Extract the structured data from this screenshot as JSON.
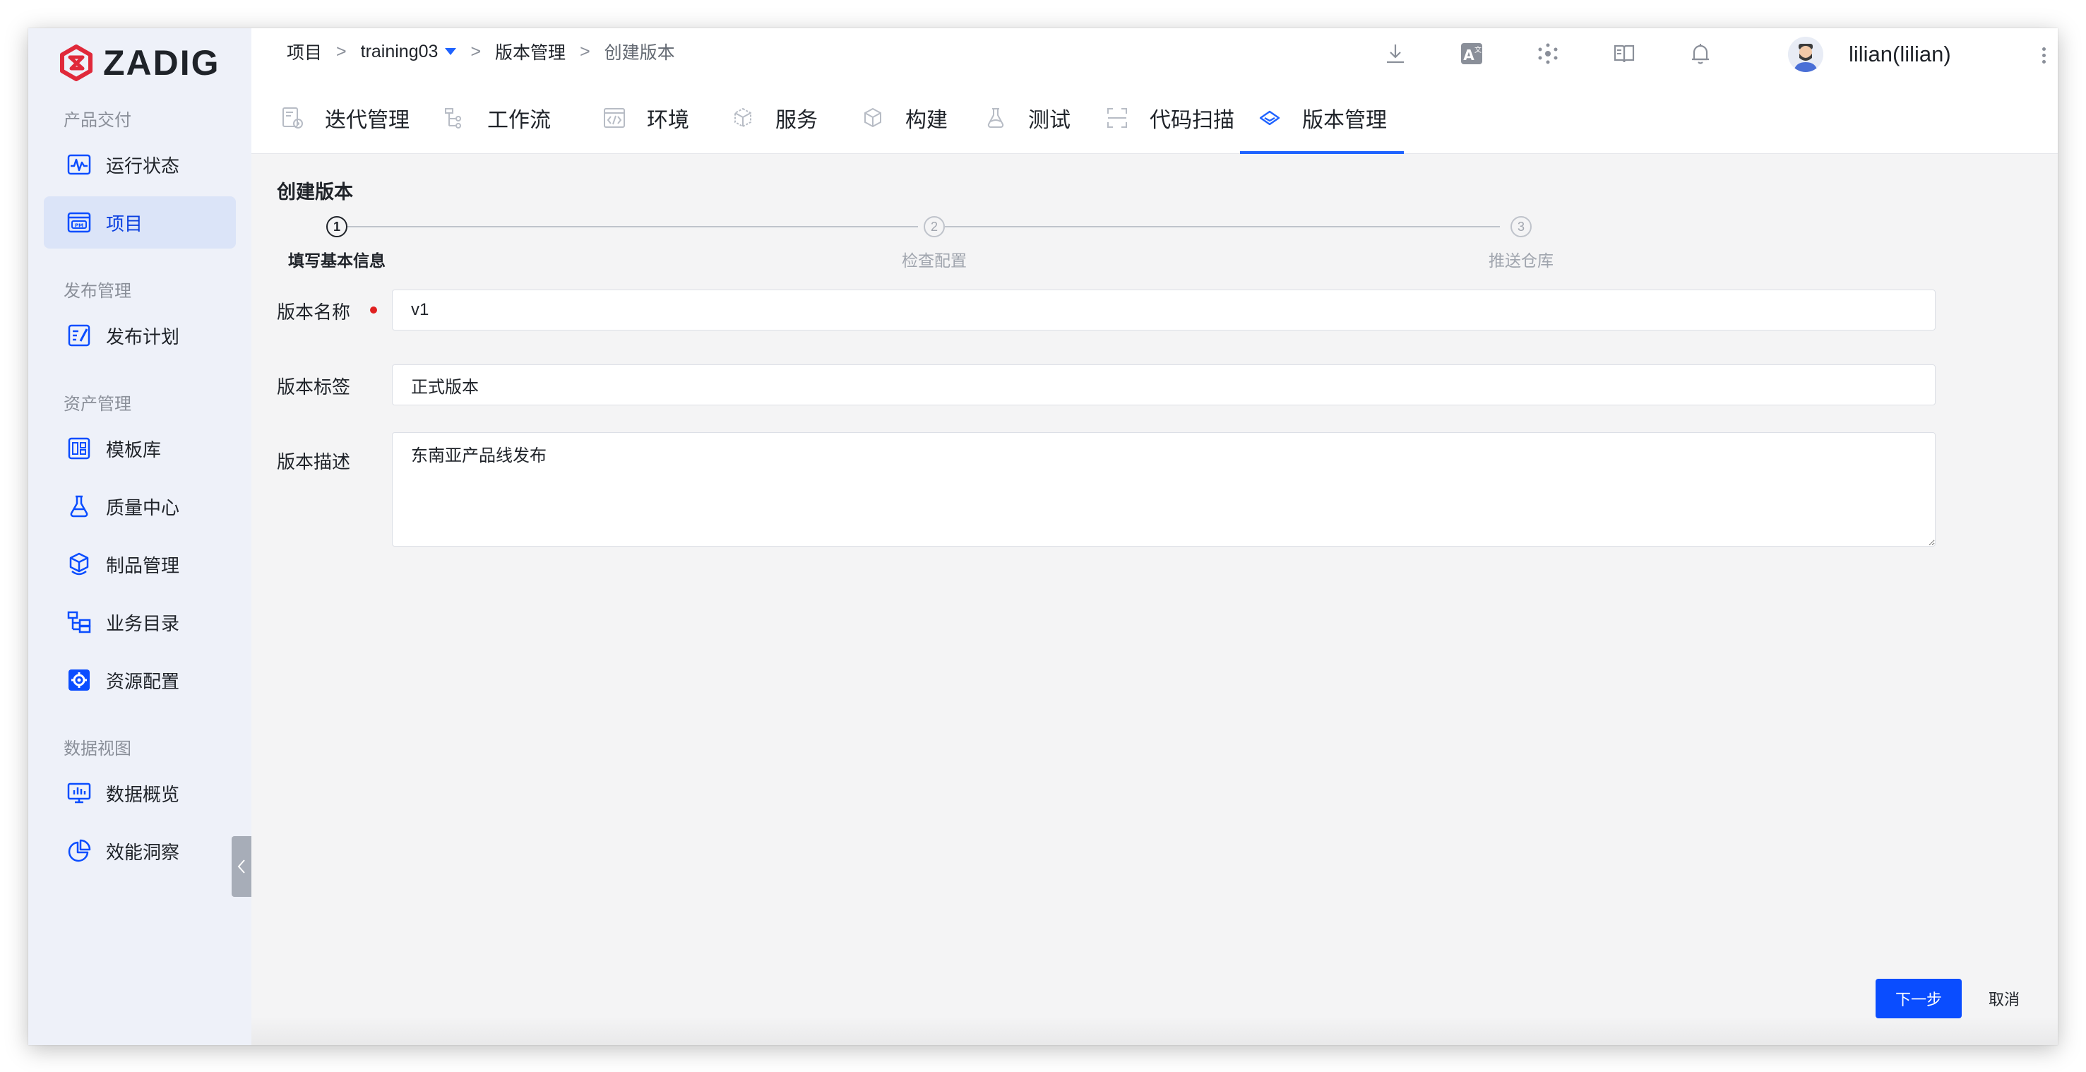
{
  "app": {
    "logo_text": "ZADIG"
  },
  "sidebar": {
    "groups": [
      {
        "label": "产品交付"
      },
      {
        "label": "发布管理"
      },
      {
        "label": "资产管理"
      },
      {
        "label": "数据视图"
      }
    ],
    "items": [
      {
        "label": "运行状态",
        "icon": "pulse-icon"
      },
      {
        "label": "项目",
        "icon": "project-pm-icon",
        "active": true
      },
      {
        "label": "发布计划",
        "icon": "release-plan-icon"
      },
      {
        "label": "模板库",
        "icon": "template-icon"
      },
      {
        "label": "质量中心",
        "icon": "flask-icon"
      },
      {
        "label": "制品管理",
        "icon": "package-icon"
      },
      {
        "label": "业务目录",
        "icon": "catalog-icon"
      },
      {
        "label": "资源配置",
        "icon": "gear-icon"
      },
      {
        "label": "数据概览",
        "icon": "monitor-chart-icon"
      },
      {
        "label": "效能洞察",
        "icon": "pie-chart-icon"
      }
    ]
  },
  "header": {
    "breadcrumb": {
      "root": "项目",
      "sep": ">",
      "project": "training03",
      "section": "版本管理",
      "current": "创建版本"
    },
    "user": {
      "name": "lilian(lilian)"
    },
    "tabs": [
      {
        "label": "迭代管理",
        "icon": "iteration-icon"
      },
      {
        "label": "工作流",
        "icon": "workflow-icon"
      },
      {
        "label": "环境",
        "icon": "code-env-icon"
      },
      {
        "label": "服务",
        "icon": "service-cube-icon"
      },
      {
        "label": "构建",
        "icon": "build-box-icon"
      },
      {
        "label": "测试",
        "icon": "test-flask-icon"
      },
      {
        "label": "代码扫描",
        "icon": "scan-icon"
      },
      {
        "label": "版本管理",
        "icon": "diamond-icon",
        "active": true
      }
    ]
  },
  "main": {
    "title": "创建版本",
    "steps": [
      {
        "num": "1",
        "label": "填写基本信息",
        "active": true
      },
      {
        "num": "2",
        "label": "检查配置",
        "active": false
      },
      {
        "num": "3",
        "label": "推送仓库",
        "active": false
      }
    ],
    "form": {
      "name": {
        "label": "版本名称",
        "value": "v1",
        "required": true
      },
      "tag": {
        "label": "版本标签",
        "value": "正式版本"
      },
      "desc": {
        "label": "版本描述",
        "value": "东南亚产品线发布"
      }
    },
    "actions": {
      "next": "下一步",
      "cancel": "取消"
    }
  },
  "colors": {
    "primary": "#0a4dff",
    "accent_underline": "#1f63ff",
    "sidebar_bg": "#eef1f9",
    "required": "#e02020",
    "logo_red": "#e0293a"
  }
}
